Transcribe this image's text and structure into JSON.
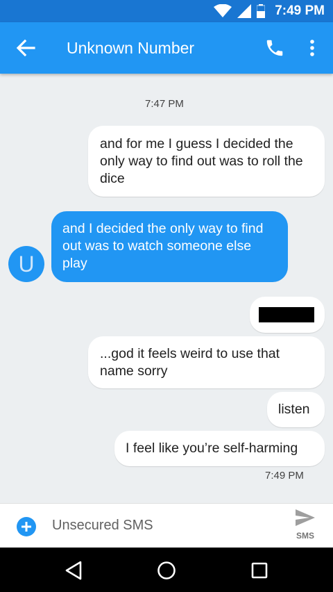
{
  "status_bar": {
    "time": "7:49 PM"
  },
  "app_bar": {
    "title": "Unknown Number"
  },
  "thread": {
    "timestamp_top": "7:47 PM",
    "messages": [
      {
        "direction": "outgoing",
        "text": "and for me I guess I decided the only way to find out was to roll the dice"
      },
      {
        "direction": "incoming",
        "text": "and I decided the only way to find out was to watch someone else play"
      },
      {
        "direction": "outgoing",
        "text": "",
        "redacted": true
      },
      {
        "direction": "outgoing",
        "text": "...god it feels weird to use that name sorry"
      },
      {
        "direction": "outgoing",
        "text": "listen"
      },
      {
        "direction": "outgoing",
        "text": "I feel like you’re self-harming"
      }
    ],
    "timestamp_bottom": "7:49 PM",
    "avatar_letter": "U"
  },
  "composer": {
    "placeholder": "Unsecured SMS",
    "send_label": "SMS"
  },
  "colors": {
    "primary": "#2196f3",
    "primary_dark": "#1976d2",
    "background": "#eceff1"
  }
}
